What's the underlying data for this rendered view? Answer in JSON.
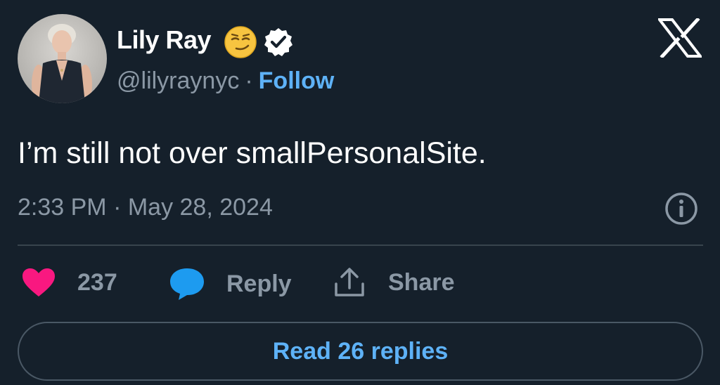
{
  "author": {
    "display_name": "Lily Ray",
    "handle": "@lilyraynyc",
    "separator": "·",
    "follow_label": "Follow",
    "emoji": "smirking-face-emoji",
    "verified": true
  },
  "brand": {
    "logo": "x-logo-icon"
  },
  "tweet": {
    "text": "I’m still not over smallPersonalSite.",
    "timestamp": "2:33 PM · May 28, 2024"
  },
  "actions": {
    "like_count": "237",
    "reply_label": "Reply",
    "share_label": "Share"
  },
  "footer": {
    "read_replies_label": "Read 26 replies"
  },
  "colors": {
    "background": "#15202b",
    "text_primary": "#ffffff",
    "text_secondary": "#8b98a5",
    "accent_blue": "#5eb2f7",
    "like_pink": "#f91880",
    "reply_blue": "#1d9bf0",
    "divider": "#38444d"
  }
}
